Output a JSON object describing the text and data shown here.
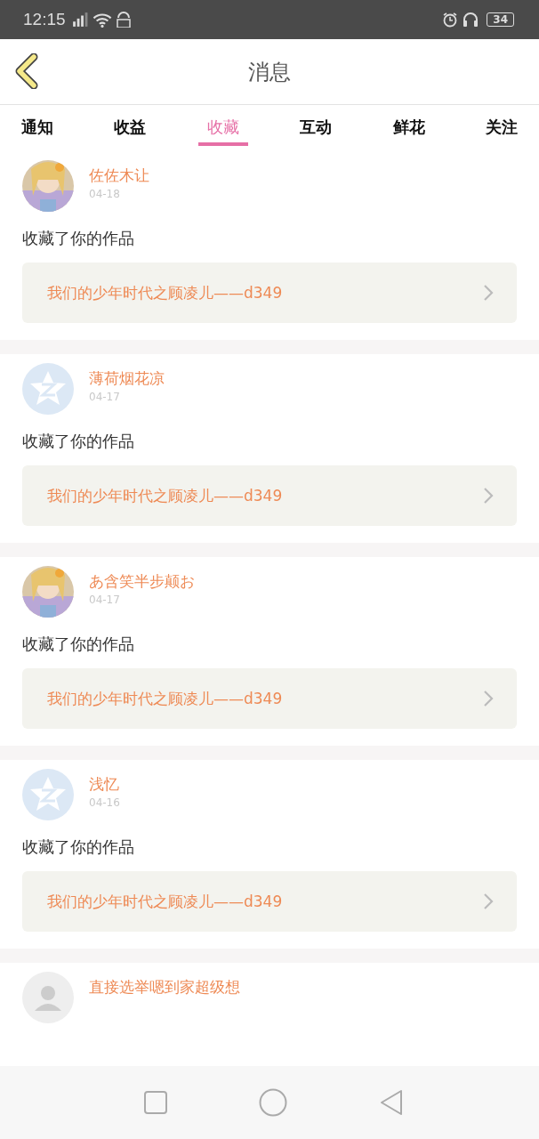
{
  "status_bar": {
    "time": "12:15",
    "battery": "34"
  },
  "header": {
    "title": "消息"
  },
  "tabs": [
    {
      "label": "通知",
      "selected": false
    },
    {
      "label": "收益",
      "selected": false
    },
    {
      "label": "收藏",
      "selected": true
    },
    {
      "label": "互动",
      "selected": false
    },
    {
      "label": "鲜花",
      "selected": false
    },
    {
      "label": "关注",
      "selected": false
    }
  ],
  "messages": [
    {
      "kind": "picture",
      "name": "佐佐木让",
      "date": "04-18",
      "text": "收藏了你的作品",
      "work": "我们的少年时代之顾凌儿——d349"
    },
    {
      "kind": "default",
      "name": "薄荷烟花凉",
      "date": "04-17",
      "text": "收藏了你的作品",
      "work": "我们的少年时代之顾凌儿——d349"
    },
    {
      "kind": "picture",
      "name": "あ含笑半步颠お",
      "date": "04-17",
      "text": "收藏了你的作品",
      "work": "我们的少年时代之顾凌儿——d349"
    },
    {
      "kind": "default",
      "name": "浅忆",
      "date": "04-16",
      "text": "收藏了你的作品",
      "work": "我们的少年时代之顾凌儿——d349"
    },
    {
      "kind": "person",
      "name": "直接选举嗯到家超级想"
    }
  ]
}
